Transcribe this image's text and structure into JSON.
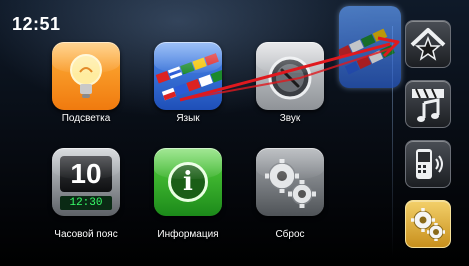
{
  "status": {
    "time": "12:51"
  },
  "tiles": [
    {
      "id": "backlight",
      "label": "Подсветка",
      "icon": "lightbulb-icon"
    },
    {
      "id": "language",
      "label": "Язык",
      "icon": "flags-icon"
    },
    {
      "id": "sound",
      "label": "Звук",
      "icon": "volume-knob-icon"
    },
    {
      "id": "timezone",
      "label": "Часовой пояс",
      "icon": "flip-clock-icon",
      "clock_big": "10",
      "clock_small": "12:30"
    },
    {
      "id": "info",
      "label": "Информация",
      "icon": "info-icon",
      "glyph": "i"
    },
    {
      "id": "reset",
      "label": "Сброс",
      "icon": "gears-icon"
    }
  ],
  "sidebar": {
    "items": [
      {
        "id": "home",
        "icon": "home-star-icon",
        "active": false
      },
      {
        "id": "media",
        "icon": "media-note-icon",
        "active": false
      },
      {
        "id": "phone",
        "icon": "phone-icon",
        "active": false
      },
      {
        "id": "settings",
        "icon": "gears-icon",
        "active": true
      }
    ]
  },
  "colors": {
    "accent": "#e8b43a",
    "arrow": "#e0191e",
    "background": "#0a111c"
  }
}
